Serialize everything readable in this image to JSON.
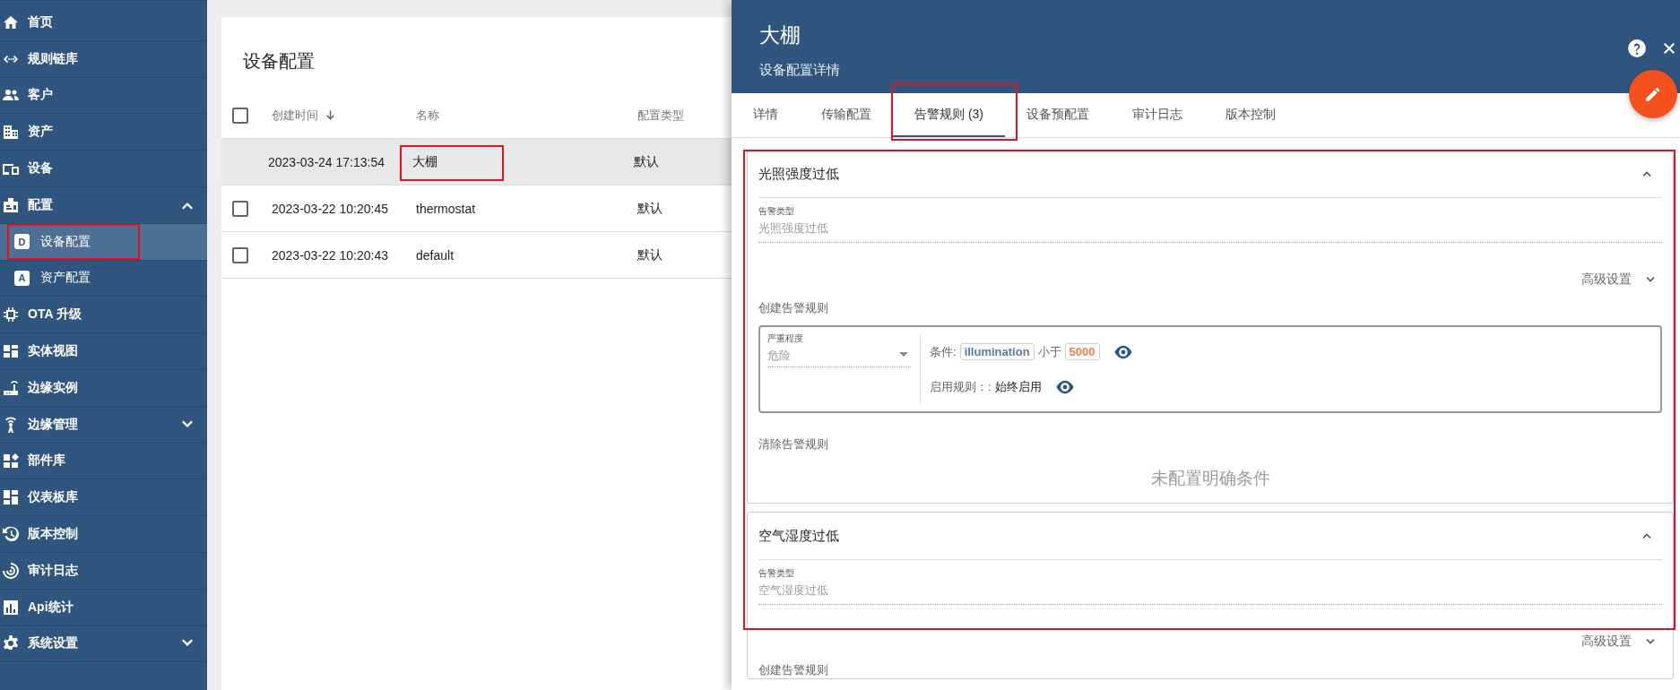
{
  "sidebar": {
    "items": [
      {
        "label": "首页",
        "selected": false
      },
      {
        "label": "规则链库",
        "selected": false
      },
      {
        "label": "客户",
        "selected": false
      },
      {
        "label": "资产",
        "selected": false
      },
      {
        "label": "设备",
        "selected": false
      },
      {
        "label": "配置",
        "selected": false,
        "expanded": true,
        "children": [
          {
            "label": "设备配置",
            "badge": "D",
            "selected": true,
            "highlighted": true
          },
          {
            "label": "资产配置",
            "badge": "A",
            "selected": false,
            "highlighted": false
          }
        ]
      },
      {
        "label": "OTA 升级",
        "selected": false
      },
      {
        "label": "实体视图",
        "selected": false
      },
      {
        "label": "边缘实例",
        "selected": false
      },
      {
        "label": "边缘管理",
        "selected": false,
        "expanded": false
      },
      {
        "label": "部件库",
        "selected": false
      },
      {
        "label": "仪表板库",
        "selected": false
      },
      {
        "label": "版本控制",
        "selected": false
      },
      {
        "label": "审计日志",
        "selected": false
      },
      {
        "label": "Api统计",
        "selected": false
      },
      {
        "label": "系统设置",
        "selected": false,
        "expanded": false
      }
    ]
  },
  "table": {
    "title": "设备配置",
    "all_checked": false,
    "columns": [
      "创建时间",
      "名称",
      "配置类型"
    ],
    "rows": [
      {
        "cells": [
          "2023-03-24 17:13:54",
          "大棚",
          "默认"
        ],
        "selected": true,
        "has_checkbox": false,
        "name_highlighted": true
      },
      {
        "cells": [
          "2023-03-22 10:20:45",
          "thermostat",
          "默认"
        ],
        "selected": false,
        "has_checkbox": true,
        "checked": false,
        "name_highlighted": false
      },
      {
        "cells": [
          "2023-03-22 10:20:43",
          "default",
          "默认"
        ],
        "selected": false,
        "has_checkbox": true,
        "checked": false,
        "name_highlighted": false
      }
    ]
  },
  "drawer": {
    "title": "大棚",
    "subtitle": "设备配置详情",
    "tabs": [
      {
        "label": "详情",
        "selected": false,
        "highlighted": false
      },
      {
        "label": "传输配置",
        "selected": false,
        "highlighted": false
      },
      {
        "label": "告警规则 (3)",
        "selected": true,
        "highlighted": true
      },
      {
        "label": "设备预配置",
        "selected": false,
        "highlighted": false
      },
      {
        "label": "审计日志",
        "selected": false,
        "highlighted": false
      },
      {
        "label": "版本控制",
        "selected": false,
        "highlighted": false
      }
    ],
    "content_highlighted": true,
    "alarms": [
      {
        "title": "光照强度过低",
        "expanded": true,
        "type_label": "告警类型",
        "type_value": "光照强度过低",
        "advanced": "高级设置",
        "create_label": "创建告警规则",
        "rule": {
          "severity_label": "严重程度",
          "severity": "危险",
          "condition_label": "条件:",
          "key": "illumination",
          "operator": "小于",
          "value": "5000",
          "schedule_label": "启用规则：:",
          "schedule": "始终启用"
        },
        "clear_label": "清除告警规则",
        "clear_empty": "未配置明确条件"
      },
      {
        "title": "空气湿度过低",
        "expanded": true,
        "type_label": "告警类型",
        "type_value": "空气湿度过低",
        "advanced": "高级设置",
        "create_label": "创建告警规则"
      }
    ]
  }
}
